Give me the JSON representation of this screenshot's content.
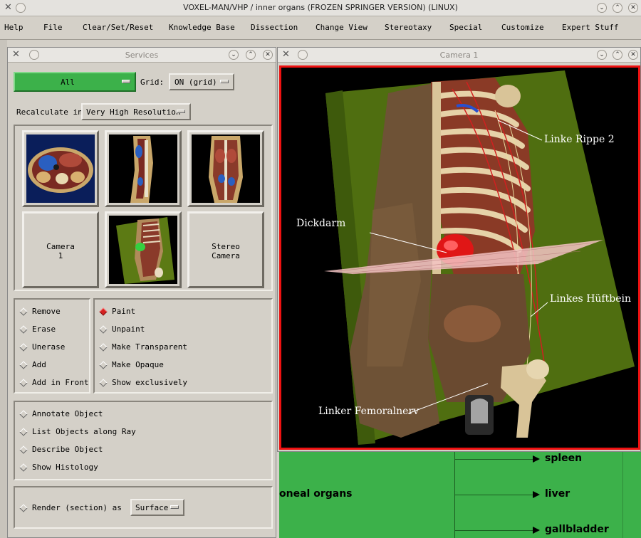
{
  "app": {
    "title": "VOXEL-MAN/VHP / inner organs (FROZEN SPRINGER VERSION) (LINUX)"
  },
  "menu": [
    "Help",
    "File",
    "Clear/Set/Reset",
    "Knowledge Base",
    "Dissection",
    "Change View",
    "Stereotaxy",
    "Special",
    "Customize",
    "Expert Stuff"
  ],
  "services": {
    "title": "Services",
    "filter_value": "All",
    "grid_label": "Grid:",
    "grid_value": "ON (grid)",
    "recalc_label": "Recalculate in",
    "recalc_value": "Very High Resolution",
    "thumbs": {
      "camera1_label": "Camera\n1",
      "stereo_label": "Stereo\nCamera"
    },
    "actions_left": [
      "Remove",
      "Erase",
      "Unerase",
      "Add",
      "Add in Front"
    ],
    "actions_right": [
      "Paint",
      "Unpaint",
      "Make Transparent",
      "Make Opaque",
      "Show exclusively"
    ],
    "selected_action": "Paint",
    "object_actions": [
      "Annotate Object",
      "List Objects along Ray",
      "Describe Object",
      "Show Histology"
    ],
    "render_label": "Render (section) as",
    "render_value": "Surface"
  },
  "camera": {
    "title": "Camera 1",
    "labels": {
      "rib": "Linke Rippe 2",
      "colon": "Dickdarm",
      "hip": "Linkes Hüftbein",
      "nerve": "Linker Femoralnerv"
    }
  },
  "tree": {
    "branch_label": "oneal organs",
    "leaves": [
      "spleen",
      "liver",
      "gallbladder"
    ]
  },
  "colors": {
    "accent_green": "#3cb14a",
    "highlight_red": "#ee1111"
  }
}
